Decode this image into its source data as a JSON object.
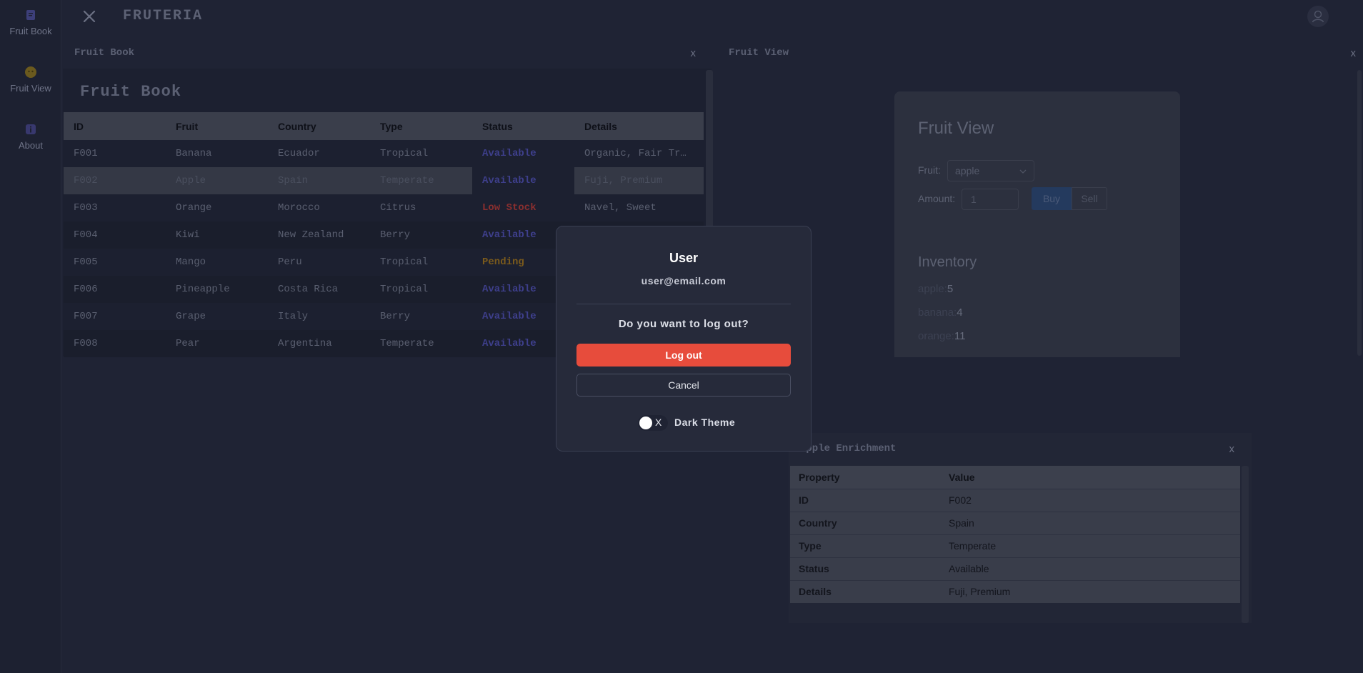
{
  "sidebar": {
    "items": [
      {
        "label": "Fruit Book",
        "icon": "book-icon"
      },
      {
        "label": "Fruit View",
        "icon": "fruit-icon"
      },
      {
        "label": "About",
        "icon": "info-icon"
      }
    ]
  },
  "topbar": {
    "brand": "FRUTERIA"
  },
  "fruit_book_panel": {
    "header": "Fruit Book",
    "title": "Fruit Book",
    "close": "x",
    "columns": [
      "ID",
      "Fruit",
      "Country",
      "Type",
      "Status",
      "Details"
    ],
    "rows": [
      {
        "id": "F001",
        "fruit": "Banana",
        "country": "Ecuador",
        "type": "Tropical",
        "status": "Available",
        "details": "Organic, Fair Tr…"
      },
      {
        "id": "F002",
        "fruit": "Apple",
        "country": "Spain",
        "type": "Temperate",
        "status": "Available",
        "details": "Fuji, Premium"
      },
      {
        "id": "F003",
        "fruit": "Orange",
        "country": "Morocco",
        "type": "Citrus",
        "status": "Low Stock",
        "details": "Navel, Sweet"
      },
      {
        "id": "F004",
        "fruit": "Kiwi",
        "country": "New Zealand",
        "type": "Berry",
        "status": "Available",
        "details": ""
      },
      {
        "id": "F005",
        "fruit": "Mango",
        "country": "Peru",
        "type": "Tropical",
        "status": "Pending",
        "details": ""
      },
      {
        "id": "F006",
        "fruit": "Pineapple",
        "country": "Costa Rica",
        "type": "Tropical",
        "status": "Available",
        "details": ""
      },
      {
        "id": "F007",
        "fruit": "Grape",
        "country": "Italy",
        "type": "Berry",
        "status": "Available",
        "details": ""
      },
      {
        "id": "F008",
        "fruit": "Pear",
        "country": "Argentina",
        "type": "Temperate",
        "status": "Available",
        "details": ""
      }
    ]
  },
  "fruit_view_panel": {
    "header": "Fruit View",
    "close": "x",
    "title": "Fruit View",
    "fruit_label": "Fruit:",
    "fruit_value": "apple",
    "amount_label": "Amount:",
    "amount_value": "1",
    "buy_label": "Buy",
    "sell_label": "Sell",
    "inventory_title": "Inventory",
    "inventory": [
      {
        "name": "apple:",
        "count": "5"
      },
      {
        "name": "banana:",
        "count": "4"
      },
      {
        "name": "orange:",
        "count": "11"
      }
    ]
  },
  "enrichment_panel": {
    "header": "Apple Enrichment",
    "close": "x",
    "columns": [
      "Property",
      "Value"
    ],
    "rows": [
      {
        "property": "ID",
        "value": "F002"
      },
      {
        "property": "Country",
        "value": "Spain"
      },
      {
        "property": "Type",
        "value": "Temperate"
      },
      {
        "property": "Status",
        "value": "Available"
      },
      {
        "property": "Details",
        "value": "Fuji, Premium"
      }
    ]
  },
  "modal": {
    "name": "User",
    "email": "user@email.com",
    "question": "Do you want to log out?",
    "logout_label": "Log out",
    "cancel_label": "Cancel",
    "toggle_mark": "X",
    "theme_label": "Dark Theme"
  },
  "colors": {
    "logout": "#e74c3c",
    "available": "#3e3f8c",
    "low_stock": "#8a2f2f",
    "pending": "#7a5a1c"
  }
}
